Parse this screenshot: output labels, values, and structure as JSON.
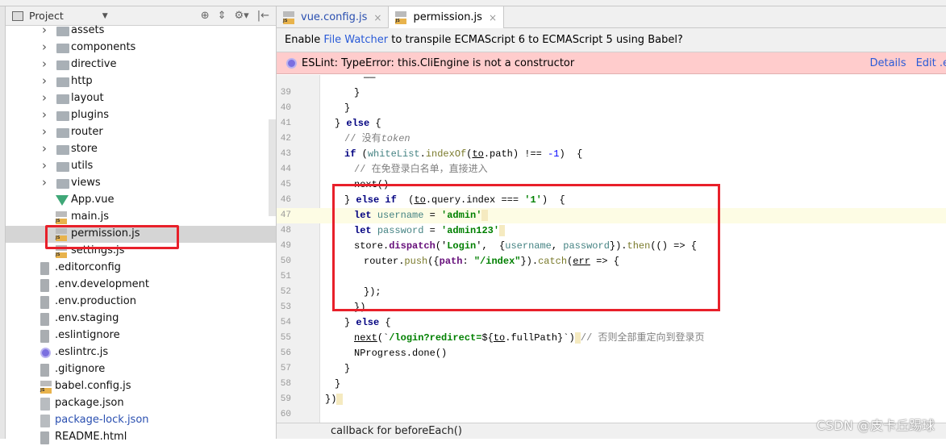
{
  "project": {
    "title": "Project",
    "dropdown": "▼",
    "tools": [
      "⊕",
      "⇕",
      "⚙▾",
      "|←"
    ]
  },
  "tree": [
    {
      "label": "assets",
      "type": "folder",
      "level": 1
    },
    {
      "label": "components",
      "type": "folder",
      "level": 1
    },
    {
      "label": "directive",
      "type": "folder",
      "level": 1
    },
    {
      "label": "http",
      "type": "folder",
      "level": 1
    },
    {
      "label": "layout",
      "type": "folder",
      "level": 1
    },
    {
      "label": "plugins",
      "type": "folder",
      "level": 1
    },
    {
      "label": "router",
      "type": "folder",
      "level": 1
    },
    {
      "label": "store",
      "type": "folder",
      "level": 1
    },
    {
      "label": "utils",
      "type": "folder",
      "level": 1
    },
    {
      "label": "views",
      "type": "folder",
      "level": 1
    },
    {
      "label": "App.vue",
      "type": "vue",
      "level": 1
    },
    {
      "label": "main.js",
      "type": "js",
      "level": 1
    },
    {
      "label": "permission.js",
      "type": "js",
      "level": 1,
      "selected": true
    },
    {
      "label": "settings.js",
      "type": "js",
      "level": 1
    },
    {
      "label": ".editorconfig",
      "type": "txt",
      "level": 0
    },
    {
      "label": ".env.development",
      "type": "txt",
      "level": 0
    },
    {
      "label": ".env.production",
      "type": "txt",
      "level": 0
    },
    {
      "label": ".env.staging",
      "type": "txt",
      "level": 0
    },
    {
      "label": ".eslintignore",
      "type": "txt",
      "level": 0
    },
    {
      "label": ".eslintrc.js",
      "type": "esl",
      "level": 0
    },
    {
      "label": ".gitignore",
      "type": "txt",
      "level": 0
    },
    {
      "label": "babel.config.js",
      "type": "js",
      "level": 0
    },
    {
      "label": "package.json",
      "type": "json",
      "level": 0
    },
    {
      "label": "package-lock.json",
      "type": "json",
      "level": 0,
      "color": "#2a4fb0"
    },
    {
      "label": "README.html",
      "type": "txt",
      "level": 0
    }
  ],
  "tabs": [
    {
      "label": "vue.config.js",
      "active": false
    },
    {
      "label": "permission.js",
      "active": true
    }
  ],
  "tab_close": "×",
  "banner": {
    "pre": "Enable ",
    "link": "File Watcher",
    "post": " to transpile ECMAScript 6 to ECMAScript 5 using Babel?"
  },
  "eslint": {
    "message": "ESLint: TypeError: this.CliEngine is not a constructor",
    "details": "Details",
    "edit": "Edit .e"
  },
  "code": [
    {
      "n": "",
      "i": 4,
      "t": [
        [
          "——",
          "pl"
        ]
      ]
    },
    {
      "n": "39",
      "i": 3,
      "t": [
        [
          "}",
          "pl"
        ]
      ]
    },
    {
      "n": "40",
      "i": 2,
      "t": [
        [
          "}",
          "pl"
        ]
      ]
    },
    {
      "n": "41",
      "i": 1,
      "t": [
        [
          "} ",
          "pl"
        ],
        [
          "else",
          "kw"
        ],
        [
          " {",
          "pl"
        ]
      ]
    },
    {
      "n": "42",
      "i": 2,
      "t": [
        [
          "// 没有",
          "cmz"
        ],
        [
          "token",
          "cm"
        ]
      ]
    },
    {
      "n": "43",
      "i": 2,
      "t": [
        [
          "if",
          "kw"
        ],
        [
          " (",
          "pl"
        ],
        [
          "whiteList",
          "var"
        ],
        [
          ".",
          "pl"
        ],
        [
          "indexOf",
          "fn"
        ],
        [
          "(",
          "pl"
        ],
        [
          "to",
          "ul"
        ],
        [
          ".path) !== ",
          "pl"
        ],
        [
          "-1",
          "num"
        ],
        [
          ")  {",
          "pl"
        ]
      ]
    },
    {
      "n": "44",
      "i": 3,
      "t": [
        [
          "// 在免登录白名单，直接进入",
          "cmz"
        ]
      ]
    },
    {
      "n": "45",
      "i": 3,
      "t": [
        [
          "next()",
          "pl"
        ]
      ]
    },
    {
      "n": "46",
      "i": 2,
      "t": [
        [
          "} ",
          "pl"
        ],
        [
          "else if",
          "kw"
        ],
        [
          "  (",
          "pl"
        ],
        [
          "to",
          "ul"
        ],
        [
          ".query.index === ",
          "pl"
        ],
        [
          "'1'",
          "str"
        ],
        [
          ")  {",
          "pl"
        ]
      ]
    },
    {
      "n": "47",
      "i": 3,
      "cur": true,
      "t": [
        [
          "let",
          "kw"
        ],
        [
          " ",
          "pl"
        ],
        [
          "username",
          "var"
        ],
        [
          " = ",
          "pl"
        ],
        [
          "'admin'",
          "str"
        ],
        [
          " ",
          "caret"
        ]
      ]
    },
    {
      "n": "48",
      "i": 3,
      "t": [
        [
          "let",
          "kw"
        ],
        [
          " ",
          "pl"
        ],
        [
          "password",
          "var"
        ],
        [
          " = ",
          "pl"
        ],
        [
          "'admin123'",
          "str"
        ],
        [
          " ",
          "caret"
        ]
      ]
    },
    {
      "n": "49",
      "i": 3,
      "t": [
        [
          "store.",
          "pl"
        ],
        [
          "dispatch",
          "prop"
        ],
        [
          "('",
          "pl"
        ],
        [
          "Login",
          "str"
        ],
        [
          "',  {",
          "pl"
        ],
        [
          "username",
          "var"
        ],
        [
          ", ",
          "pl"
        ],
        [
          "password",
          "var"
        ],
        [
          "}).",
          "pl"
        ],
        [
          "then",
          "fn"
        ],
        [
          "(() => {",
          "pl"
        ]
      ]
    },
    {
      "n": "50",
      "i": 4,
      "t": [
        [
          "router.",
          "pl"
        ],
        [
          "push",
          "fn"
        ],
        [
          "({",
          "pl"
        ],
        [
          "path",
          "prop"
        ],
        [
          ": ",
          "pl"
        ],
        [
          "\"/index\"",
          "str"
        ],
        [
          "}).",
          "pl"
        ],
        [
          "catch",
          "fn"
        ],
        [
          "(",
          "pl"
        ],
        [
          "err",
          "ul"
        ],
        [
          " => {",
          "pl"
        ]
      ]
    },
    {
      "n": "51",
      "i": 4,
      "t": []
    },
    {
      "n": "52",
      "i": 4,
      "t": [
        [
          "});",
          "pl"
        ]
      ]
    },
    {
      "n": "53",
      "i": 3,
      "t": [
        [
          "})",
          "pl"
        ]
      ]
    },
    {
      "n": "54",
      "i": 2,
      "t": [
        [
          "} ",
          "pl"
        ],
        [
          "else",
          "kw"
        ],
        [
          " {",
          "pl"
        ]
      ]
    },
    {
      "n": "55",
      "i": 3,
      "t": [
        [
          "next",
          "ul"
        ],
        [
          "(`",
          "pl"
        ],
        [
          "/login?redirect=",
          "str"
        ],
        [
          "${",
          "pl"
        ],
        [
          "to",
          "ul"
        ],
        [
          ".fullPath}`)",
          "pl"
        ],
        [
          " ",
          "caret"
        ],
        [
          "// 否则全部重定向到登录页",
          "cmz"
        ]
      ]
    },
    {
      "n": "56",
      "i": 3,
      "t": [
        [
          "NProgress.done()",
          "pl"
        ]
      ]
    },
    {
      "n": "57",
      "i": 2,
      "t": [
        [
          "}",
          "pl"
        ]
      ]
    },
    {
      "n": "58",
      "i": 1,
      "t": [
        [
          "}",
          "pl"
        ]
      ]
    },
    {
      "n": "59",
      "i": 0,
      "t": [
        [
          "})",
          "pl"
        ],
        [
          " ",
          "caret"
        ]
      ]
    },
    {
      "n": "60",
      "i": 0,
      "t": []
    }
  ],
  "status": "callback for beforeEach()",
  "watermark": "CSDN @皮卡丘踢球",
  "colors": {
    "highlight_box": "#e8202a",
    "eslint_bg": "#ffcccc",
    "link": "#2a5bd7"
  }
}
